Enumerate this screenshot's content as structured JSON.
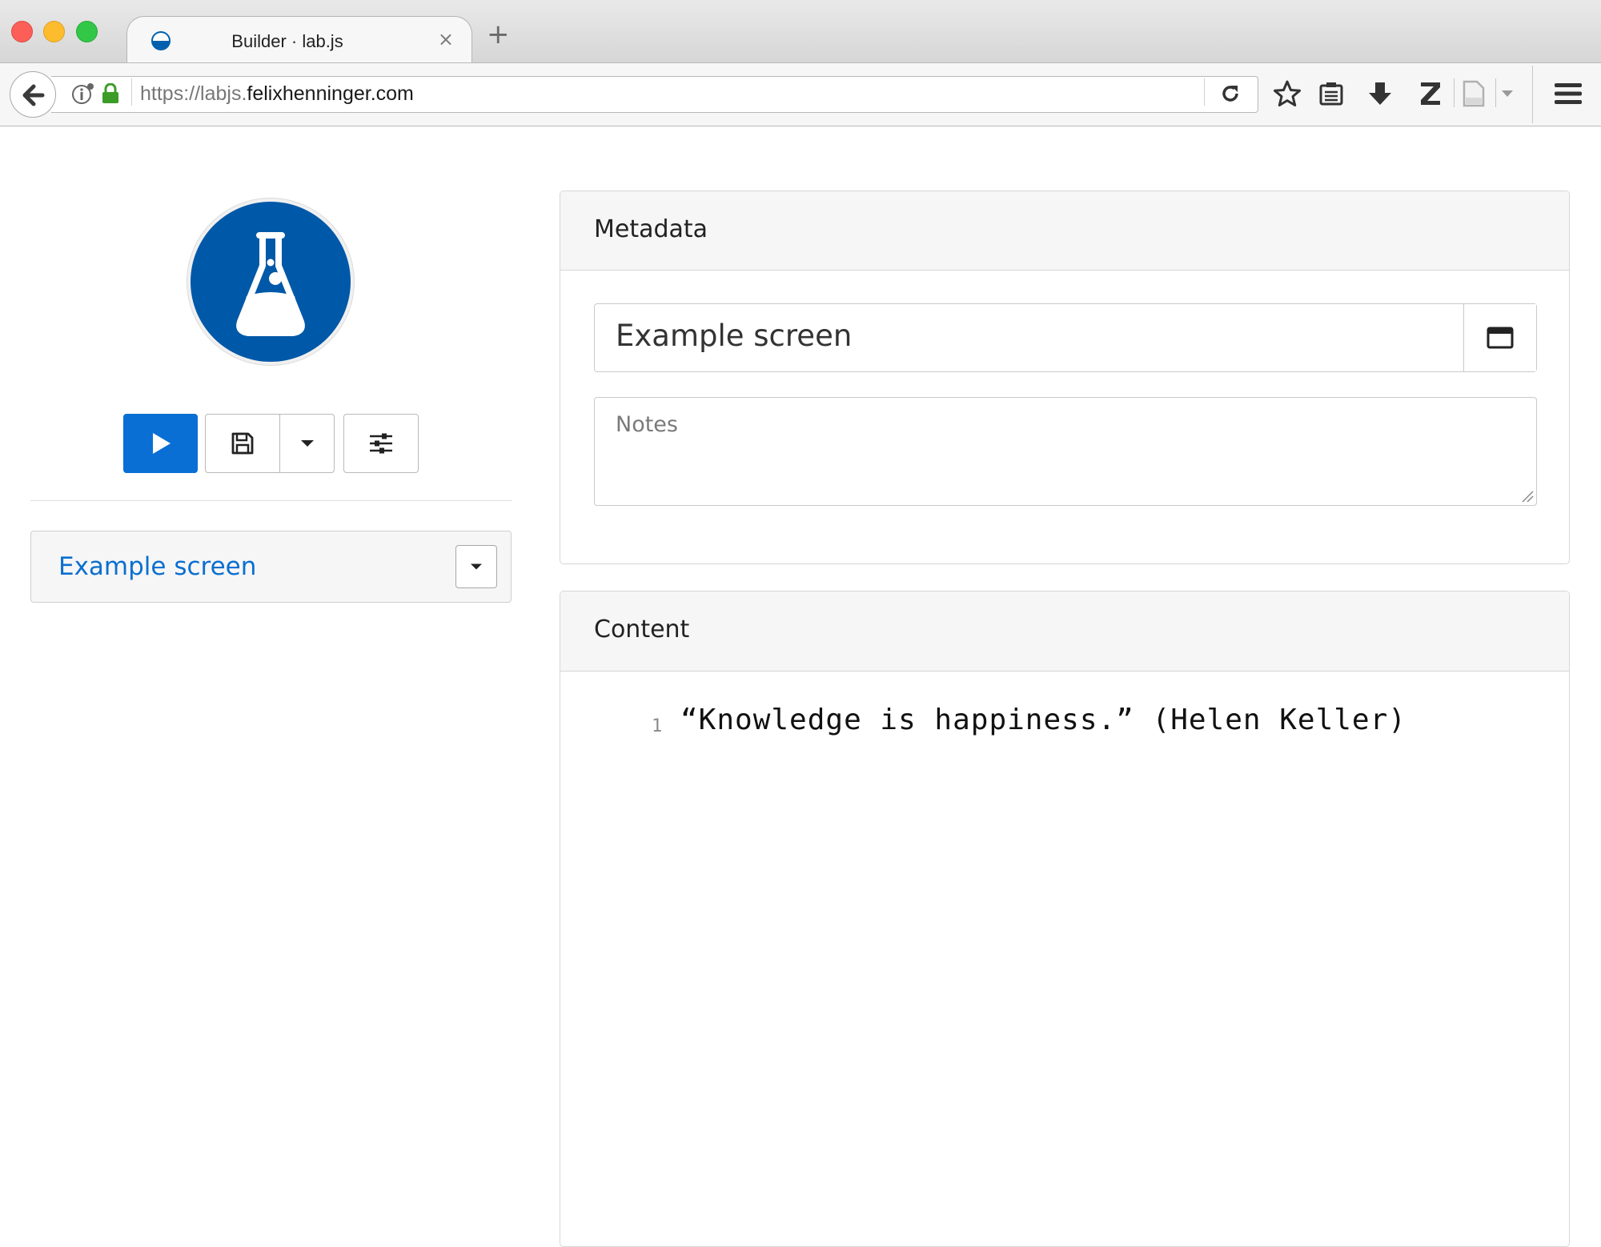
{
  "browser": {
    "tab_title": "Builder · lab.js",
    "tab_close": "×",
    "new_tab": "+",
    "url_prefix": "https://labjs.",
    "url_domain": "felixhenninger.com"
  },
  "toolbar": {
    "run_icon": "play-icon",
    "save_icon": "floppy-disk-icon",
    "dropdown_icon": "caret-down-icon",
    "options_icon": "sliders-icon",
    "run_color": "#0a6fd4"
  },
  "sidebar": {
    "logo_icon": "flask-icon",
    "logo_color": "#0058a8",
    "node_label": "Example screen",
    "node_label_color": "#0b6fcf"
  },
  "metadata": {
    "header": "Metadata",
    "title_value": "Example screen",
    "notes_placeholder": "Notes"
  },
  "content": {
    "header": "Content",
    "line_number": "1",
    "code_line": "“Knowledge is happiness.” (Helen Keller)"
  }
}
